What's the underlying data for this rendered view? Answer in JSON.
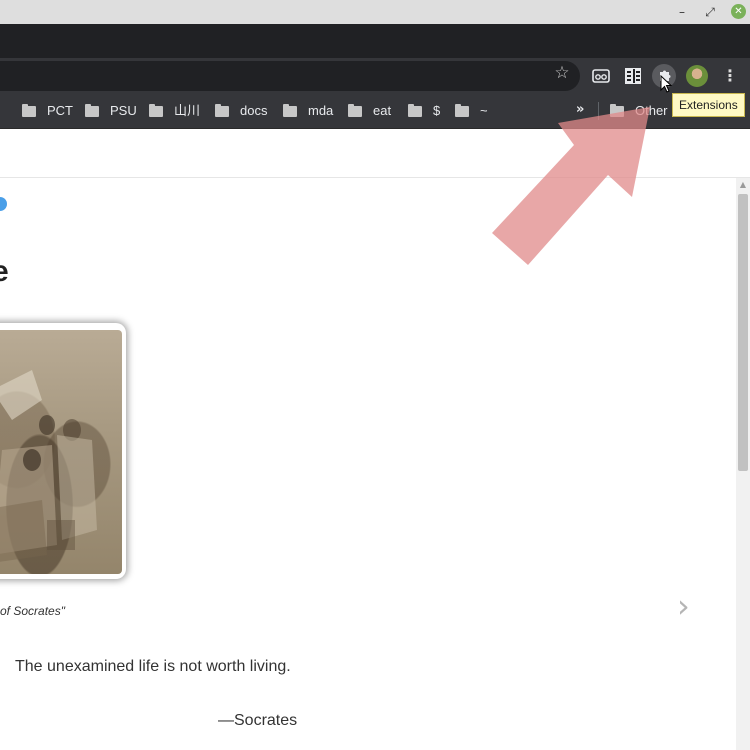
{
  "window": {
    "minimize": "–",
    "restore": "⤢",
    "close": "✕"
  },
  "toolbar": {
    "star_icon": "star-icon",
    "menu": "⋮"
  },
  "bookmarks": [
    {
      "label": "PCT"
    },
    {
      "label": "PSU"
    },
    {
      "label": "山川"
    },
    {
      "label": "docs"
    },
    {
      "label": "mda"
    },
    {
      "label": "eat"
    },
    {
      "label": "$"
    },
    {
      "label": "~"
    }
  ],
  "bookmarks_overflow": "»",
  "other_bookmarks": "Other",
  "tooltip": "Extensions",
  "page": {
    "heading_fragment": "e",
    "caption": "of Socrates\"",
    "next": "›",
    "quote": "The unexamined life is not worth living.",
    "author": "—Socrates"
  },
  "colors": {
    "annotation_arrow": "#e08a8a",
    "tooltip_bg": "#fff9c4"
  }
}
